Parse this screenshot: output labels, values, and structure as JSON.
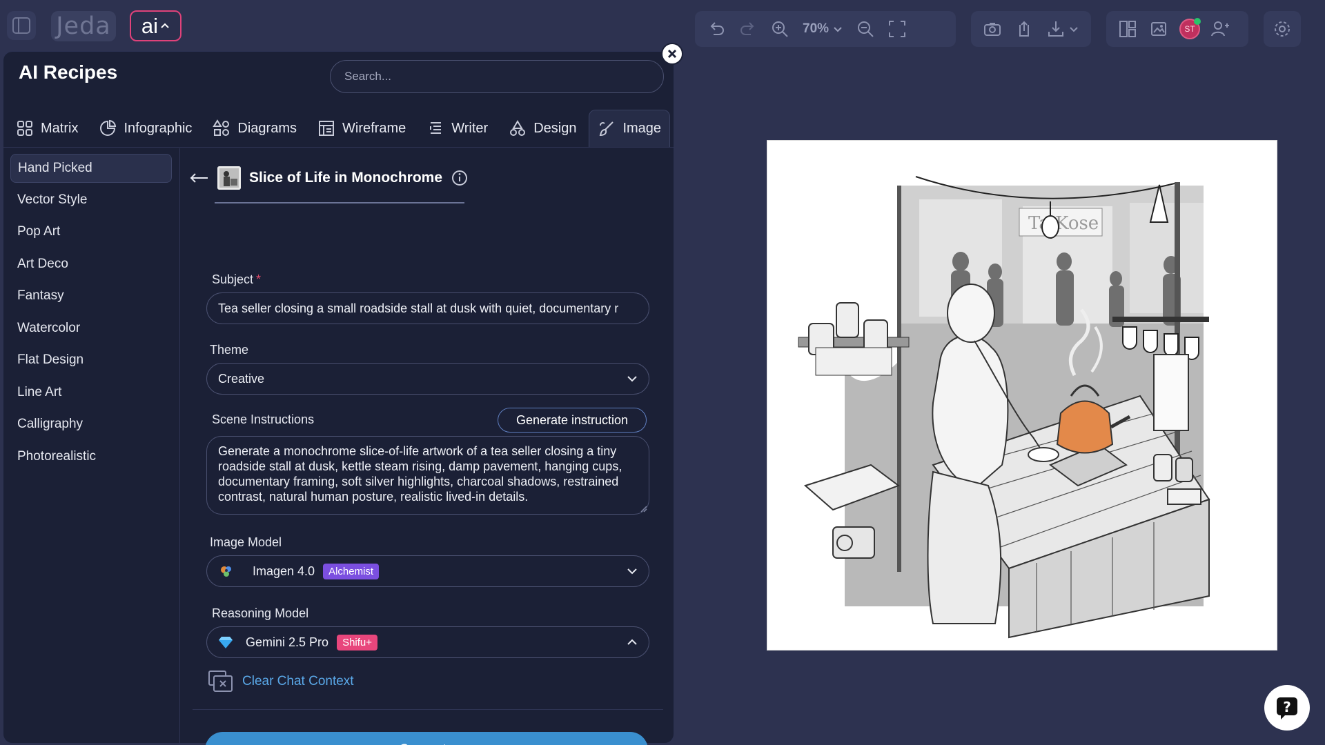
{
  "app": {
    "logo_text": "Jeda",
    "ai_label": "ai"
  },
  "toolbar": {
    "zoom_level": "70%",
    "avatar_initials": "ST"
  },
  "panel": {
    "title": "AI Recipes",
    "search_placeholder": "Search...",
    "tabs": [
      {
        "label": "Matrix",
        "icon": "grid-icon"
      },
      {
        "label": "Infographic",
        "icon": "pie-chart-icon"
      },
      {
        "label": "Diagrams",
        "icon": "shapes-icon"
      },
      {
        "label": "Wireframe",
        "icon": "wireframe-icon"
      },
      {
        "label": "Writer",
        "icon": "text-icon"
      },
      {
        "label": "Design",
        "icon": "design-icon"
      },
      {
        "label": "Image",
        "icon": "brush-icon",
        "active": true
      }
    ],
    "categories": [
      {
        "label": "Hand Picked",
        "active": true
      },
      {
        "label": "Vector Style"
      },
      {
        "label": "Pop Art"
      },
      {
        "label": "Art Deco"
      },
      {
        "label": "Fantasy"
      },
      {
        "label": "Watercolor"
      },
      {
        "label": "Flat Design"
      },
      {
        "label": "Line Art"
      },
      {
        "label": "Calligraphy"
      },
      {
        "label": "Photorealistic"
      }
    ]
  },
  "recipe": {
    "title": "Slice of Life in Monochrome",
    "subject_label": "Subject",
    "required_mark": "*",
    "subject_value": "Tea seller closing a small roadside stall at dusk with quiet, documentary r",
    "theme_label": "Theme",
    "theme_value": "Creative",
    "scene_label": "Scene Instructions",
    "generate_instruction_label": "Generate instruction",
    "scene_text": "Generate a monochrome slice-of-life artwork of a tea seller closing a tiny roadside stall at dusk, kettle steam rising, damp pavement, hanging cups, documentary framing, soft silver highlights, charcoal shadows, restrained contrast, natural human posture, realistic lived-in details.",
    "image_model_label": "Image Model",
    "image_model_value": "Imagen 4.0",
    "image_model_badge": "Alchemist",
    "reasoning_model_label": "Reasoning Model",
    "reasoning_model_value": "Gemini 2.5 Pro",
    "reasoning_model_badge": "Shifu+",
    "clear_chat_label": "Clear Chat Context",
    "generate_label": "Generate"
  },
  "canvas": {
    "image_sign_text": "Ta Kose"
  },
  "colors": {
    "background": "#2d3250",
    "panel": "#1b2036",
    "accent": "#3a8fcf",
    "ai_border": "#e0427a",
    "badge_purple": "#7b4fe0",
    "badge_pink": "#e8467c"
  }
}
